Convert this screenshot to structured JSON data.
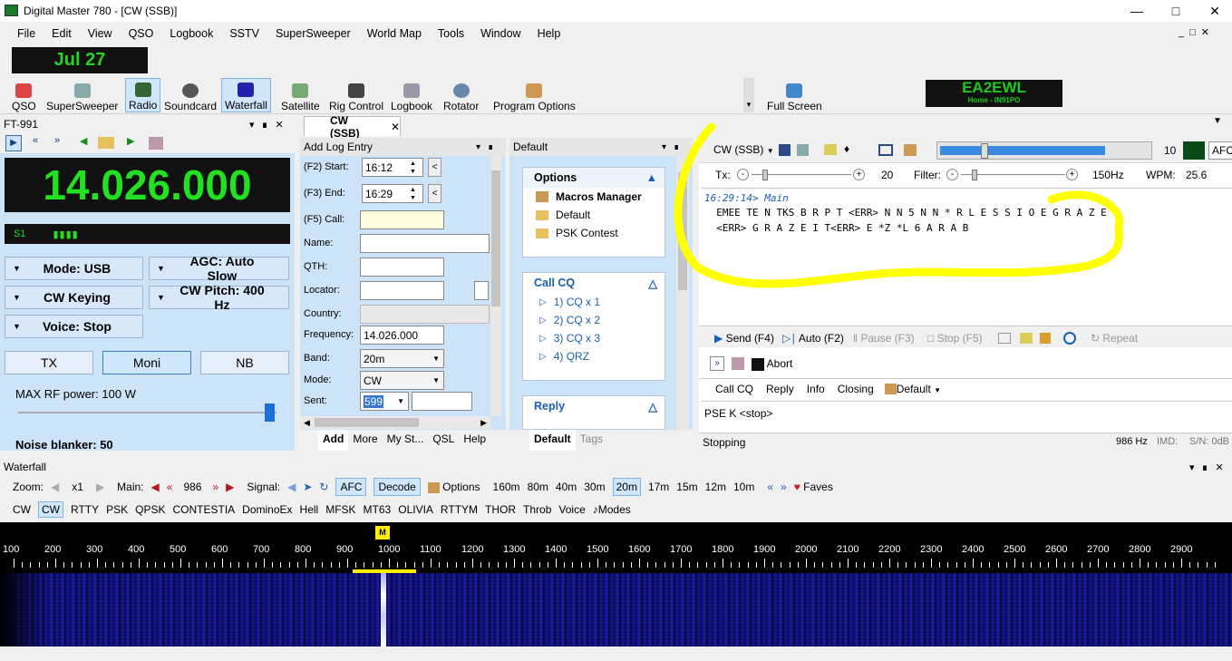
{
  "window": {
    "title": "Digital Master 780 - [CW (SSB)]"
  },
  "menu": [
    "File",
    "Edit",
    "View",
    "QSO",
    "Logbook",
    "SSTV",
    "SuperSweeper",
    "World Map",
    "Tools",
    "Window",
    "Help"
  ],
  "date": "Jul 27",
  "toolbar": [
    "QSO",
    "SuperSweeper",
    "Radio",
    "Soundcard",
    "Waterfall",
    "Satellite",
    "Rig Control",
    "Logbook",
    "Rotator",
    "Program Options",
    "Full Screen"
  ],
  "callsign": {
    "call": "EA2EWL",
    "sub": "Home - IN91PO"
  },
  "radio": {
    "title": "FT-991",
    "frequency": "14.026.000",
    "smeter": "S1",
    "mode": "Mode: USB",
    "agc": "AGC: Auto Slow",
    "keying": "CW Keying",
    "pitch": "CW Pitch: 400 Hz",
    "voice": "Voice: Stop",
    "tx": "TX",
    "moni": "Moni",
    "nb": "NB",
    "rf_label": "MAX RF power: 100 W",
    "rf_level_percent": 95,
    "nb_label": "Noise blanker: 50"
  },
  "doc_tab": "CW (SSB)",
  "log": {
    "title": "Add Log Entry",
    "start_label": "(F2) Start:",
    "start": "16:12",
    "end_label": "(F3) End:",
    "end": "16:29",
    "call_label": "(F5) Call:",
    "name_label": "Name:",
    "qth_label": "QTH:",
    "locator_label": "Locator:",
    "country_label": "Country:",
    "frequency_label": "Frequency:",
    "frequency": "14.026.000",
    "band_label": "Band:",
    "band": "20m",
    "mode_label": "Mode:",
    "mode": "CW",
    "sent_label": "Sent:",
    "sent": "599",
    "tabs": [
      "Add",
      "More",
      "My St...",
      "QSL",
      "Help"
    ]
  },
  "macros": {
    "title": "Default",
    "options_header": "Options",
    "options_items": [
      "Macros Manager",
      "Default",
      "PSK Contest"
    ],
    "callcq_header": "Call CQ",
    "callcq_items": [
      "1)  CQ x 1",
      "2)  CQ x 2",
      "3)  CQ x 3",
      "4)  QRZ"
    ],
    "reply_header": "Reply",
    "tabs": [
      "Default",
      "Tags"
    ]
  },
  "cw": {
    "mode": "CW (SSB)",
    "level": "10",
    "afc": "AFC",
    "tx_label": "Tx:",
    "tx_value": "20",
    "filter_label": "Filter:",
    "filter_value": "150Hz",
    "wpm_label": "WPM:",
    "wpm_value": "25.6",
    "rx_line1": "16:29:14> Main",
    "rx_line2": "  EMEE TE N TKS B R P T <ERR> N N 5 N N * R L E S S I O E G R A Z E E",
    "rx_line3": "  <ERR> G R A Z E I T<ERR> E *Z *L 6 A R A B",
    "send": "Send  (F4)",
    "auto": "Auto  (F2)",
    "pause": "Pause  (F3)",
    "stop": "Stop  (F5)",
    "repeat": "Repeat",
    "abort": "Abort",
    "macro_links": [
      "Call CQ",
      "Reply",
      "Info",
      "Closing"
    ],
    "macro_default": "Default",
    "tx_text": "PSE K <stop>",
    "status": "Stopping",
    "status_hz": "986 Hz",
    "status_imd": "IMD:",
    "status_sn": "S/N: 0dB"
  },
  "waterfall": {
    "title": "Waterfall",
    "zoom_label": "Zoom:",
    "zoom": "x1",
    "main_label": "Main:",
    "main": "986",
    "signal_label": "Signal:",
    "afc": "AFC",
    "decode": "Decode",
    "options": "Options",
    "bands": [
      "160m",
      "80m",
      "40m",
      "30m",
      "20m",
      "17m",
      "15m",
      "12m",
      "10m"
    ],
    "faves": "Faves",
    "modes": [
      "CW",
      "CW",
      "RTTY",
      "PSK",
      "QPSK",
      "CONTESTIA",
      "DominoEx",
      "Hell",
      "MFSK",
      "MT63",
      "OLIVIA",
      "RTTYM",
      "THOR",
      "Throb",
      "Voice"
    ],
    "modes_btn": "Modes",
    "scale": [
      "100",
      "200",
      "300",
      "400",
      "500",
      "600",
      "700",
      "800",
      "900",
      "1000",
      "1100",
      "1200",
      "1300",
      "1400",
      "1500",
      "1600",
      "1700",
      "1800",
      "1900",
      "2000",
      "2100",
      "2200",
      "2300",
      "2400",
      "2500",
      "2600",
      "2700",
      "2800",
      "2900"
    ],
    "marker": "M"
  },
  "colors": {
    "accent": "#1a5fb4",
    "led": "#22e022",
    "highlight": "#ffff00"
  }
}
